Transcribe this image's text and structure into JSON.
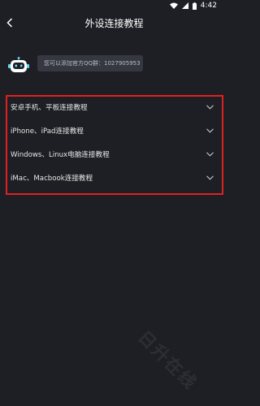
{
  "status_bar": {
    "time": "4:42"
  },
  "header": {
    "title": "外设连接教程"
  },
  "qq_notice": {
    "text": "您可以添加官方QQ群：1027905953"
  },
  "guides": [
    {
      "label": "安卓手机、平板连接教程"
    },
    {
      "label": "iPhone、iPad连接教程"
    },
    {
      "label": "Windows、Linux电脑连接教程"
    },
    {
      "label": "iMac、Macbook连接教程"
    }
  ],
  "watermark": {
    "text": "日升在线"
  },
  "colors": {
    "background": "#1d1f24",
    "highlight_border": "#e0201f",
    "robot_accent": "#6ad9f5"
  }
}
